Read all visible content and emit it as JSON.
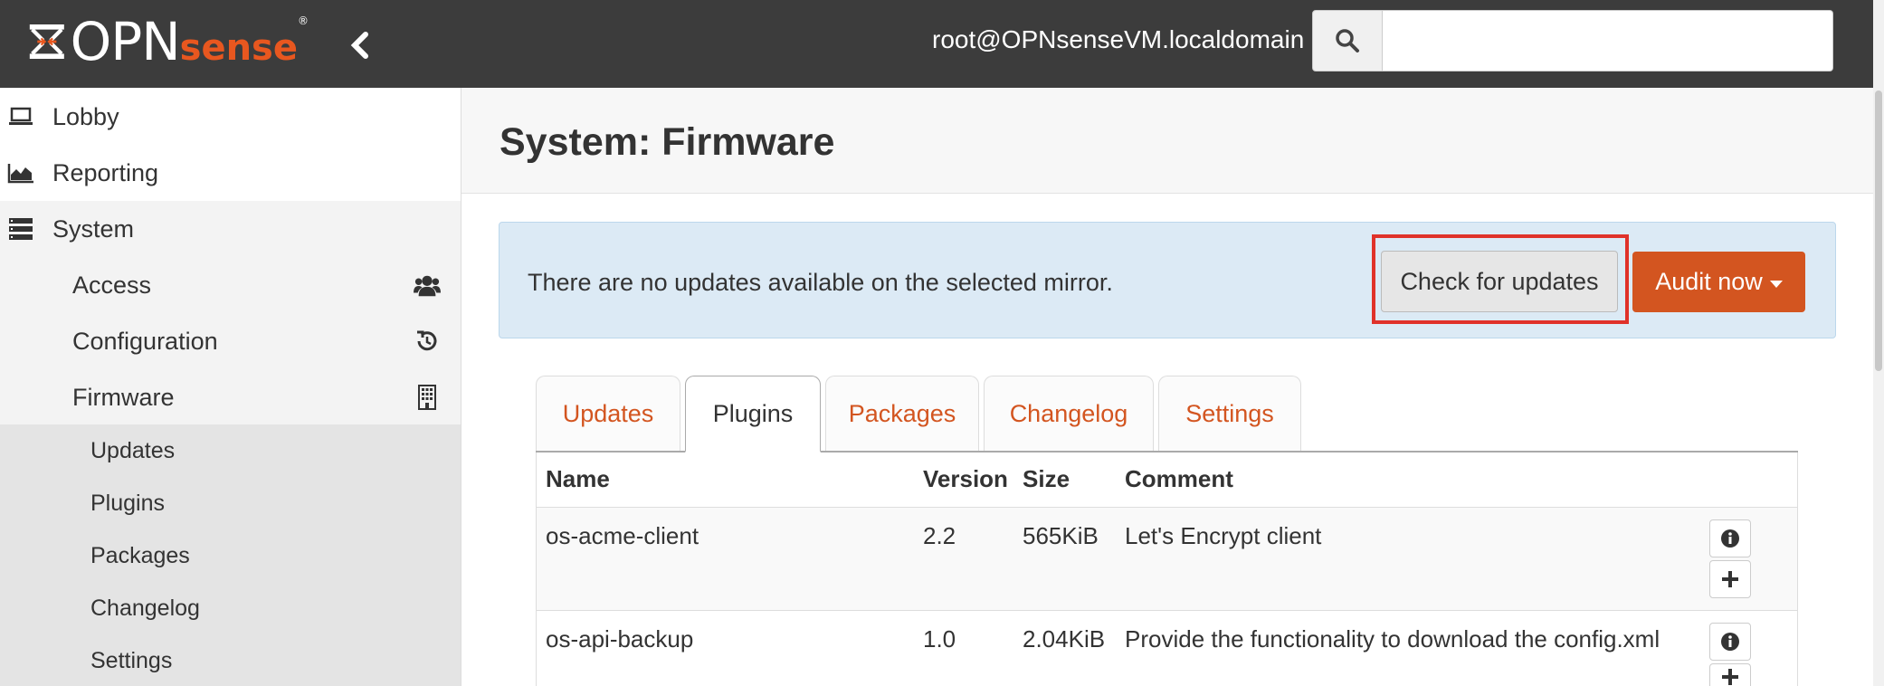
{
  "header": {
    "logo_text": "OPN",
    "logo_sense": "sense",
    "user": "root@OPNsenseVM.localdomain",
    "search_placeholder": ""
  },
  "sidebar": {
    "items": [
      {
        "label": "Lobby",
        "icon": "laptop-icon"
      },
      {
        "label": "Reporting",
        "icon": "area-chart-icon"
      },
      {
        "label": "System",
        "icon": "server-icon"
      }
    ],
    "system_children": [
      {
        "label": "Access",
        "icon": "users-icon"
      },
      {
        "label": "Configuration",
        "icon": "history-icon"
      },
      {
        "label": "Firmware",
        "icon": "building-icon"
      }
    ],
    "firmware_children": [
      {
        "label": "Updates"
      },
      {
        "label": "Plugins"
      },
      {
        "label": "Packages"
      },
      {
        "label": "Changelog"
      },
      {
        "label": "Settings"
      }
    ]
  },
  "page": {
    "title": "System: Firmware",
    "alert_text": "There are no updates available on the selected mirror.",
    "check_button": "Check for updates",
    "audit_button": "Audit now"
  },
  "tabs": [
    {
      "label": "Updates",
      "active": false
    },
    {
      "label": "Plugins",
      "active": true
    },
    {
      "label": "Packages",
      "active": false
    },
    {
      "label": "Changelog",
      "active": false
    },
    {
      "label": "Settings",
      "active": false
    }
  ],
  "table": {
    "headers": [
      "Name",
      "Version",
      "Size",
      "Comment"
    ],
    "rows": [
      {
        "name": "os-acme-client",
        "version": "2.2",
        "size": "565KiB",
        "comment": "Let's Encrypt client"
      },
      {
        "name": "os-api-backup",
        "version": "1.0",
        "size": "2.04KiB",
        "comment": "Provide the functionality to download the config.xml"
      }
    ]
  },
  "colors": {
    "accent": "#d35520",
    "header_bg": "#3c3c3c",
    "alert_bg": "#dceaf5",
    "highlight": "#e0322a"
  }
}
